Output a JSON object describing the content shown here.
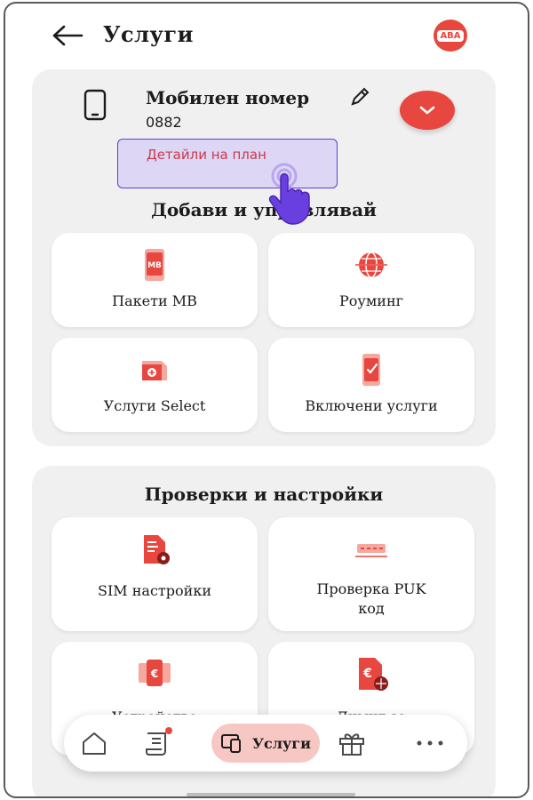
{
  "header": {
    "title": "Услуги",
    "avatar_text": "ABA",
    "back_icon": "arrow-left-icon"
  },
  "mobile": {
    "title": "Мобилен номер",
    "number": "0882",
    "plan_details": "Детайли на план"
  },
  "manage": {
    "title": "Добави и управлявай",
    "tiles": [
      {
        "label": "Пакети МВ",
        "icon": "mb-package-icon"
      },
      {
        "label": "Роуминг",
        "icon": "globe-icon"
      },
      {
        "label": "Услуги Select",
        "icon": "select-services-icon"
      },
      {
        "label": "Включени услуги",
        "icon": "included-services-icon"
      }
    ]
  },
  "checks": {
    "title": "Проверки и настройки",
    "tiles": [
      {
        "label": "SIM настройки",
        "icon": "sim-settings-icon"
      },
      {
        "label": "Проверка PUK код",
        "icon": "puk-code-icon"
      },
      {
        "label": "Устройство",
        "icon": "device-icon"
      },
      {
        "label": "Лимит за",
        "icon": "limit-icon"
      }
    ]
  },
  "nav": {
    "services_label": "Услуги"
  },
  "colors": {
    "accent": "#e8473f",
    "card_bg": "#f0f0f0",
    "highlight_bg": "#ded6f5",
    "highlight_border": "#5f3dd6",
    "nav_active": "#f7c8c3"
  }
}
